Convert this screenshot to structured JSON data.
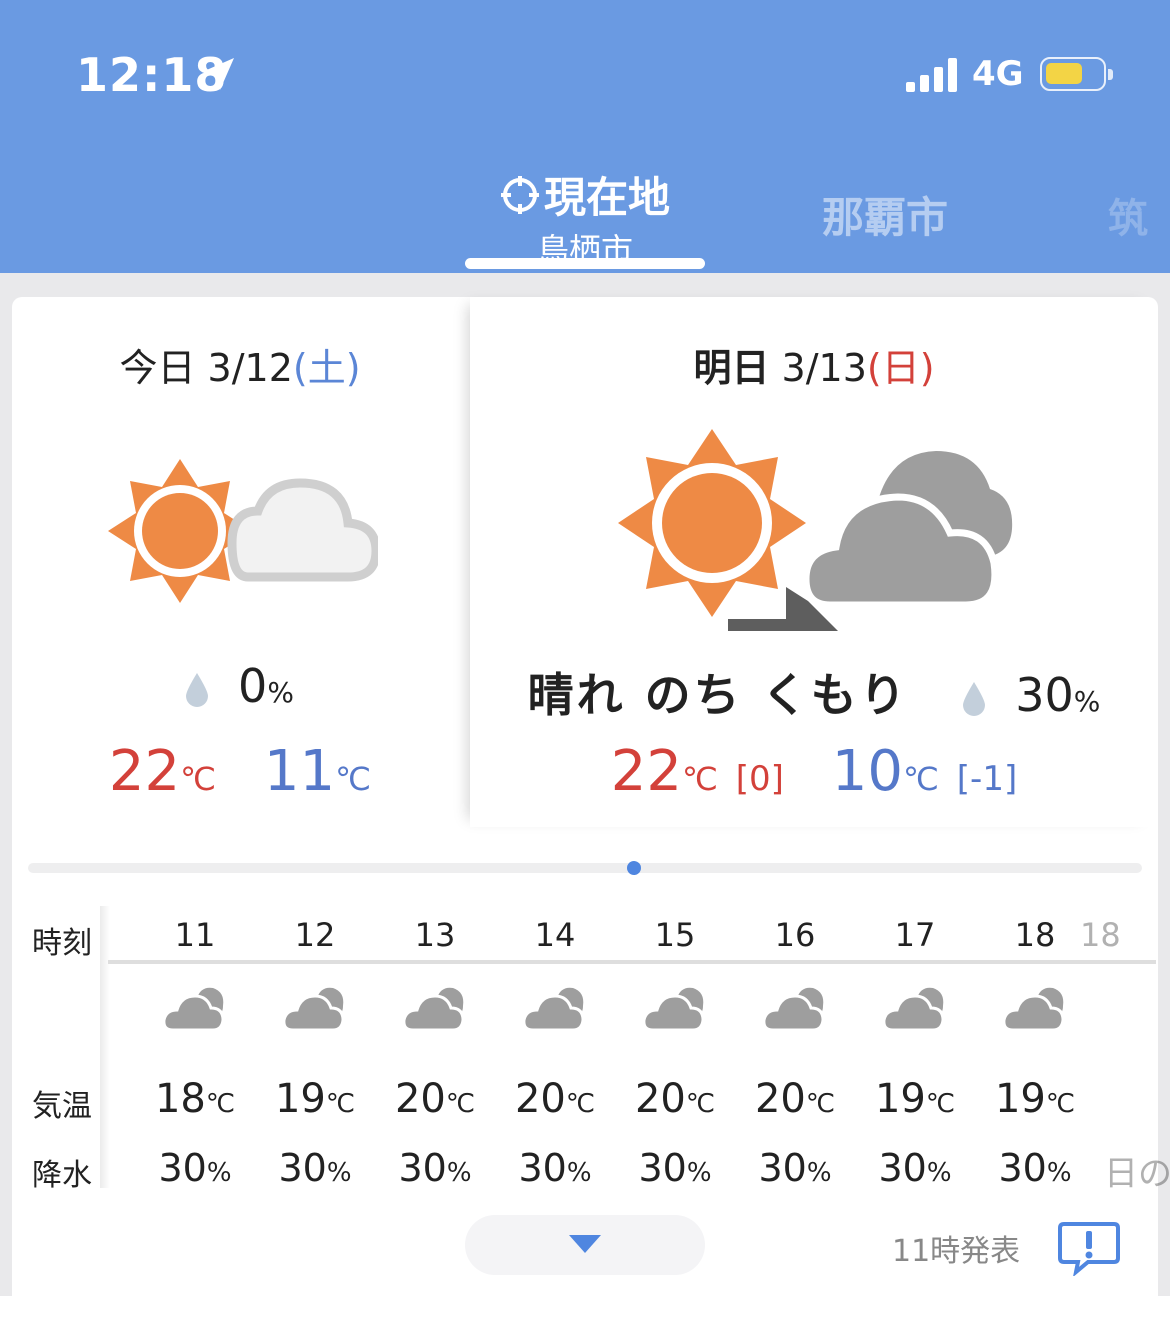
{
  "status_bar": {
    "time": "12:18",
    "network": "4G"
  },
  "tabs": {
    "active": {
      "title": "現在地",
      "subtitle": "鳥栖市"
    },
    "second": "那覇市",
    "partial": "筑"
  },
  "today": {
    "label": "今日",
    "date": "3/12",
    "weekday": "(土)",
    "weather_icon": "sun-and-cloud-icon",
    "precip": "0",
    "precip_unit": "%",
    "high": "22",
    "low": "11",
    "temp_unit": "℃"
  },
  "tomorrow": {
    "label": "明日",
    "date": "3/13",
    "weekday": "(日)",
    "weather_icon": "sun-then-cloud-icon",
    "description": "晴れ のち くもり",
    "precip": "30",
    "precip_unit": "%",
    "high": "22",
    "high_diff": "[0]",
    "low": "10",
    "low_diff": "[-1]",
    "temp_unit": "℃"
  },
  "hourly": {
    "labels": {
      "time": "時刻",
      "temp": "気温",
      "rain": "降水"
    },
    "hours": [
      {
        "hour": "11",
        "icon": "cloudy-icon",
        "temp": "18",
        "rain": "30"
      },
      {
        "hour": "12",
        "icon": "cloudy-icon",
        "temp": "19",
        "rain": "30"
      },
      {
        "hour": "13",
        "icon": "cloudy-icon",
        "temp": "20",
        "rain": "30"
      },
      {
        "hour": "14",
        "icon": "cloudy-icon",
        "temp": "20",
        "rain": "30"
      },
      {
        "hour": "15",
        "icon": "cloudy-icon",
        "temp": "20",
        "rain": "30"
      },
      {
        "hour": "16",
        "icon": "cloudy-icon",
        "temp": "20",
        "rain": "30"
      },
      {
        "hour": "17",
        "icon": "cloudy-icon",
        "temp": "19",
        "rain": "30"
      },
      {
        "hour": "18",
        "icon": "cloudy-icon",
        "temp": "19",
        "rain": "30"
      }
    ],
    "overflow_hour": "18",
    "overflow_text": "日の",
    "temp_unit": "℃",
    "rain_unit": "%"
  },
  "footer": {
    "issued": "11時発表"
  },
  "colors": {
    "header": "#6a9ae2",
    "high": "#d3413a",
    "low": "#5578c9",
    "sun": "#ee8a45"
  }
}
